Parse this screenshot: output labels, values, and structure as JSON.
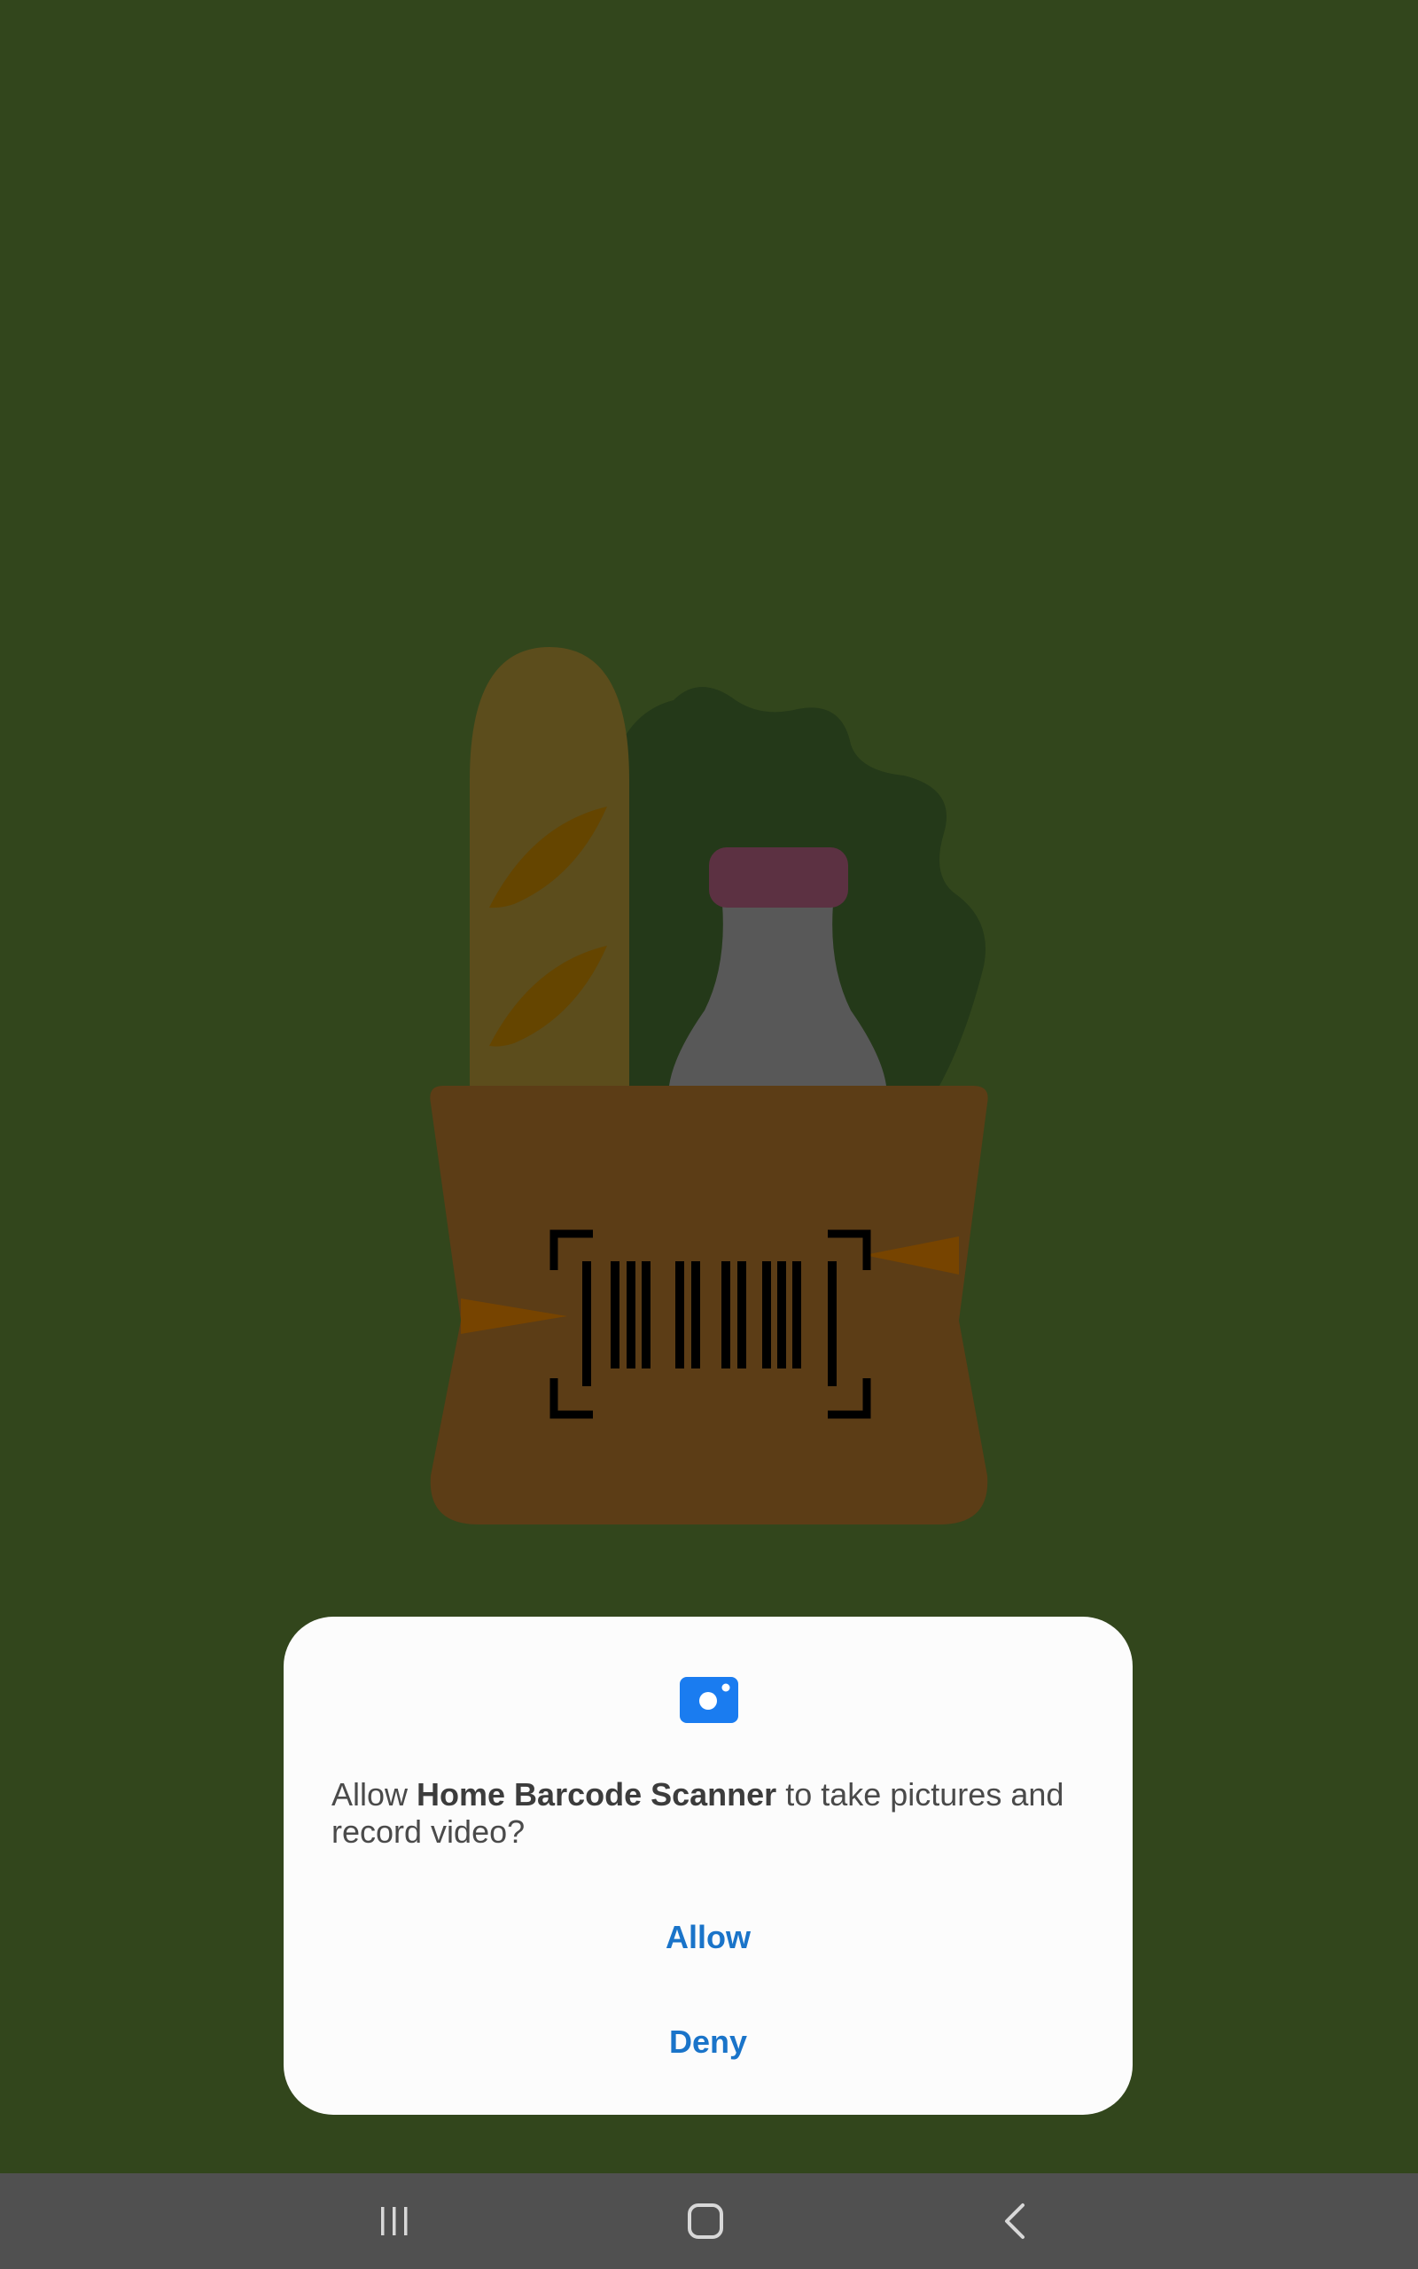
{
  "dialog": {
    "icon": "camera-icon",
    "message_prefix": "Allow ",
    "app_name": "Home Barcode Scanner",
    "message_suffix": " to take pictures and record video?",
    "allow_label": "Allow",
    "deny_label": "Deny"
  },
  "navbar": {
    "recents_icon": "recents-icon",
    "home_icon": "home-icon",
    "back_icon": "back-icon"
  },
  "colors": {
    "background": "#32461c",
    "dialog_background": "#fcfcfc",
    "button_text": "#1a74c9",
    "icon_blue": "#1a7cf0",
    "navbar": "#505050"
  }
}
